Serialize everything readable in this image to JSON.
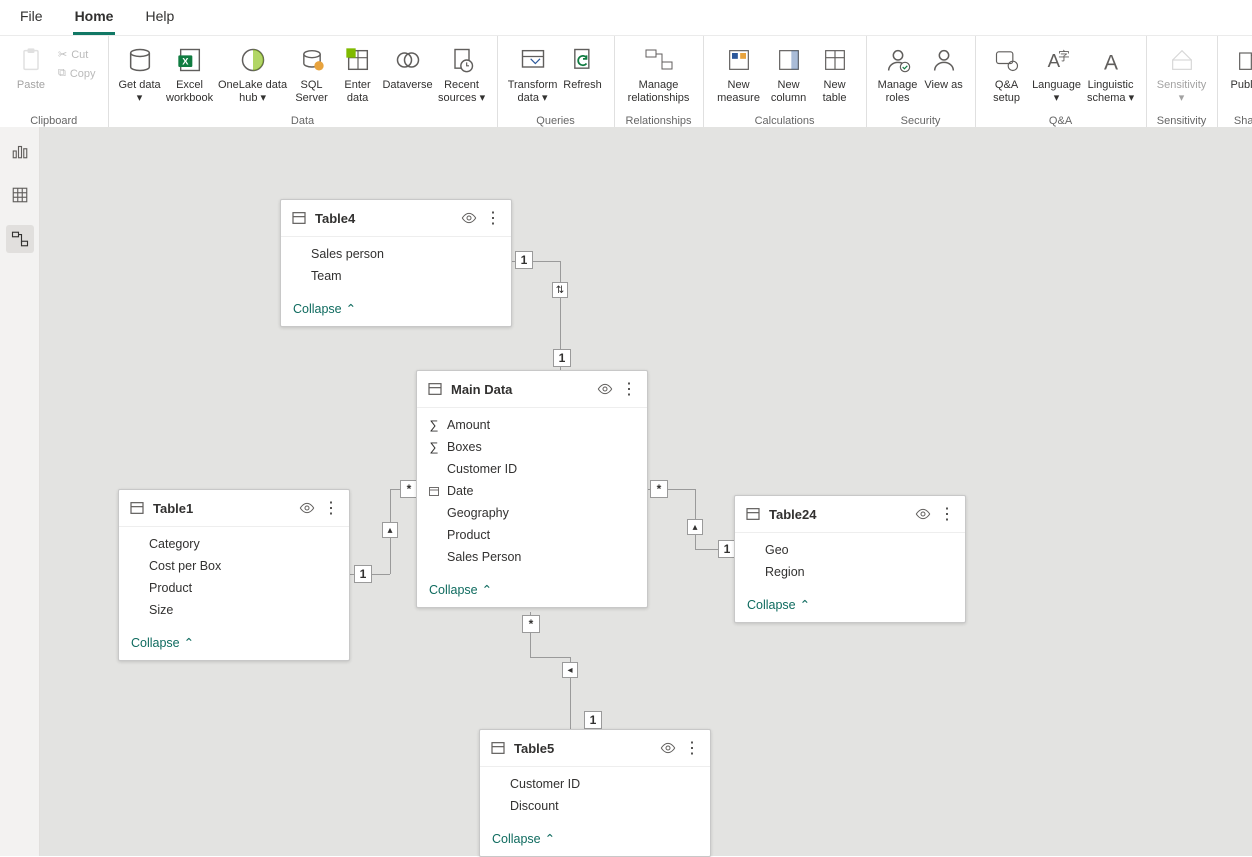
{
  "menu": {
    "file": "File",
    "home": "Home",
    "help": "Help"
  },
  "ribbon": {
    "clipboard": {
      "label": "Clipboard",
      "paste": "Paste",
      "cut": "Cut",
      "copy": "Copy"
    },
    "data": {
      "label": "Data",
      "getdata": "Get data",
      "excel": "Excel workbook",
      "onelake": "OneLake data hub",
      "sql": "SQL Server",
      "enterdata": "Enter data",
      "dataverse": "Dataverse",
      "recent": "Recent sources"
    },
    "queries": {
      "label": "Queries",
      "transform": "Transform data",
      "refresh": "Refresh"
    },
    "relationships": {
      "label": "Relationships",
      "manage": "Manage relationships"
    },
    "calculations": {
      "label": "Calculations",
      "measure": "New measure",
      "column": "New column",
      "table": "New table"
    },
    "security": {
      "label": "Security",
      "roles": "Manage roles",
      "viewas": "View as"
    },
    "qa": {
      "label": "Q&A",
      "setup": "Q&A setup",
      "language": "Language",
      "linguistic": "Linguistic schema"
    },
    "sensitivity": {
      "label": "Sensitivity",
      "btn": "Sensitivity"
    },
    "share": {
      "label": "Share",
      "publish": "Publish"
    }
  },
  "common": {
    "collapse": "Collapse",
    "dropdown_caret": ""
  },
  "tables": {
    "table4": {
      "name": "Table4",
      "fields": [
        "Sales person",
        "Team"
      ]
    },
    "maindata": {
      "name": "Main Data",
      "fields": [
        "Amount",
        "Boxes",
        "Customer ID",
        "Date",
        "Geography",
        "Product",
        "Sales Person"
      ]
    },
    "table1": {
      "name": "Table1",
      "fields": [
        "Category",
        "Cost per Box",
        "Product",
        "Size"
      ]
    },
    "table24": {
      "name": "Table24",
      "fields": [
        "Geo",
        "Region"
      ]
    },
    "table5": {
      "name": "Table5",
      "fields": [
        "Customer ID",
        "Discount"
      ]
    }
  }
}
